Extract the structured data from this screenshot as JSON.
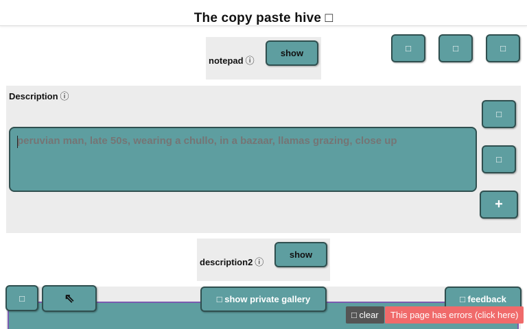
{
  "header": {
    "title": "The copy paste hive □"
  },
  "notepad": {
    "label": "notepad",
    "info_icon": "ⓘ",
    "show_label": "show"
  },
  "top_icons": [
    "□",
    "□",
    "□"
  ],
  "description": {
    "label": "Description",
    "info_icon": "ⓘ",
    "placeholder": "peruvian man, late 50s, wearing a chullo, in a bazaar, llamas grazing, close up",
    "side_buttons": [
      "□",
      "□"
    ],
    "add_label": "+"
  },
  "description2": {
    "label": "description2",
    "info_icon": "ⓘ",
    "show_label": "show"
  },
  "bottom": {
    "left_button": "□",
    "collapse_icon": "⇖",
    "private_gallery_label": "□ show private gallery",
    "feedback_label": "□ feedback"
  },
  "statusbar": {
    "clear_label": "□ clear",
    "errors_label": "This page has errors (click here)"
  }
}
